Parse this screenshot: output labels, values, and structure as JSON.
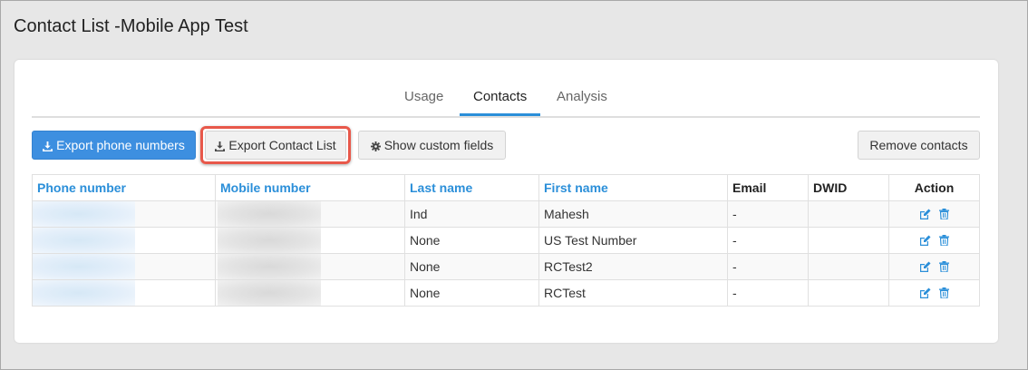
{
  "page": {
    "title_prefix": "Contact List -",
    "title_suffix": "Mobile App Test"
  },
  "tabs": [
    {
      "label": "Usage",
      "active": false
    },
    {
      "label": "Contacts",
      "active": true
    },
    {
      "label": "Analysis",
      "active": false
    }
  ],
  "toolbar": {
    "export_phone_label": "Export phone numbers",
    "export_contact_label": "Export Contact List",
    "show_custom_label": "Show custom fields",
    "remove_contacts_label": "Remove contacts"
  },
  "table": {
    "headers": [
      "Phone number",
      "Mobile number",
      "Last name",
      "First name",
      "Email",
      "DWID",
      "Action"
    ],
    "rows": [
      {
        "last_name": "Ind",
        "first_name": "Mahesh",
        "email": "-"
      },
      {
        "last_name": "None",
        "first_name": "US Test Number",
        "email": "-"
      },
      {
        "last_name": "None",
        "first_name": "RCTest2",
        "email": "-"
      },
      {
        "last_name": "None",
        "first_name": "RCTest",
        "email": "-"
      }
    ]
  },
  "colors": {
    "accent": "#2b8fd9",
    "primary_button": "#3d8fe0",
    "highlight_border": "#e8584a"
  },
  "icons": {
    "download": "download-icon",
    "gear": "gear-icon",
    "edit": "edit-icon",
    "trash": "trash-icon"
  }
}
